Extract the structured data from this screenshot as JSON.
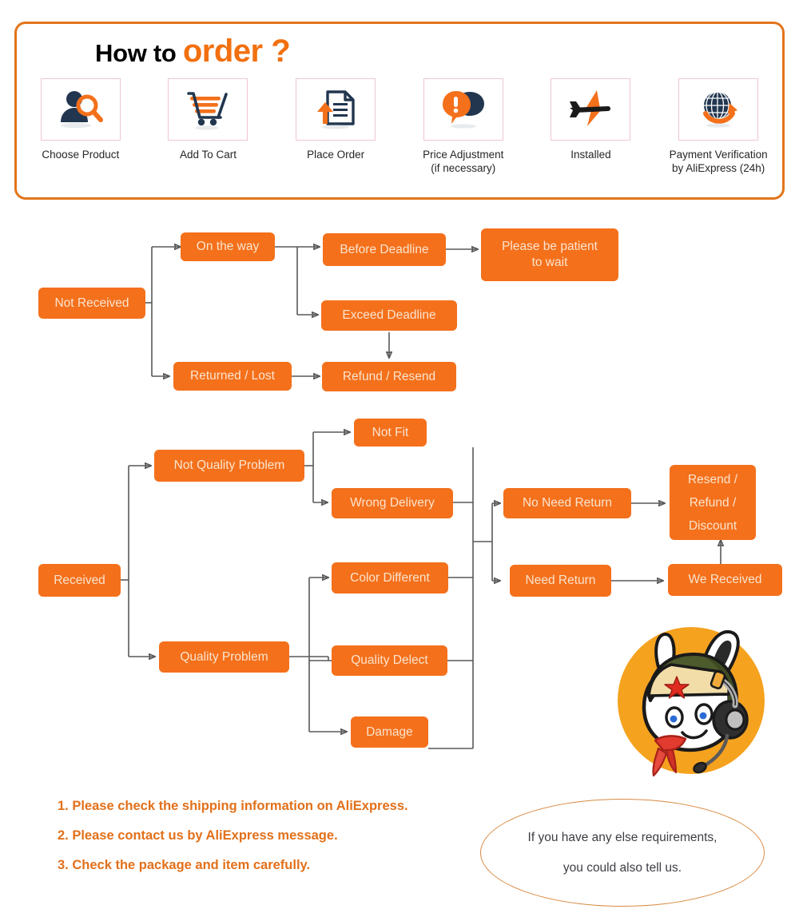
{
  "header": {
    "title_black": "How to ",
    "title_orange": "order ?",
    "steps": [
      {
        "icon": "person-search-icon",
        "label": "Choose Product"
      },
      {
        "icon": "shopping-cart-icon",
        "label": "Add To Cart"
      },
      {
        "icon": "document-upload-icon",
        "label": "Place Order"
      },
      {
        "icon": "speech-bubbles-alert-icon",
        "label": "Price Adjustment\n(if necessary)"
      },
      {
        "icon": "airplane-icon",
        "label": "Installed"
      },
      {
        "icon": "globe-arrow-icon",
        "label": "Payment Verification\nby AliExpress (24h)"
      }
    ]
  },
  "flow_not_received": {
    "nodes": {
      "not_received": "Not Received",
      "on_the_way": "On the way",
      "returned_lost": "Returned / Lost",
      "before_deadline": "Before Deadline",
      "exceed_deadline": "Exceed Deadline",
      "refund_resend": "Refund / Resend",
      "please_wait": "Please be patient\nto wait"
    }
  },
  "flow_received": {
    "nodes": {
      "received": "Received",
      "not_quality_problem": "Not Quality Problem",
      "quality_problem": "Quality Problem",
      "not_fit": "Not Fit",
      "wrong_delivery": "Wrong Delivery",
      "color_different": "Color Different",
      "quality_delect": "Quality Delect",
      "damage": "Damage",
      "no_need_return": "No Need Return",
      "need_return": "Need Return",
      "resend_refund_discount": "Resend /\nRefund /\nDiscount",
      "we_received": "We Received"
    }
  },
  "notes": [
    "1. Please check the shipping information on AliExpress.",
    "2. Please contact us by AliExpress message.",
    "3. Check the package and item carefully."
  ],
  "callout": {
    "line1": "If you have any else requirements,",
    "line2": "you could also tell us."
  },
  "mascot": {
    "name": "mi-bunny-support-mascot"
  },
  "colors": {
    "orange_node": "#F4701B",
    "orange_accent": "#E2701A",
    "header_border": "#E2751B",
    "icon_box_border": "#EFC6D2",
    "node_text": "#FBE4CE",
    "connector": "#595959",
    "title_black": "#000000",
    "title_orange": "#F2700F",
    "navy_icon": "#22364F",
    "ellipse_border": "#D98B43"
  }
}
